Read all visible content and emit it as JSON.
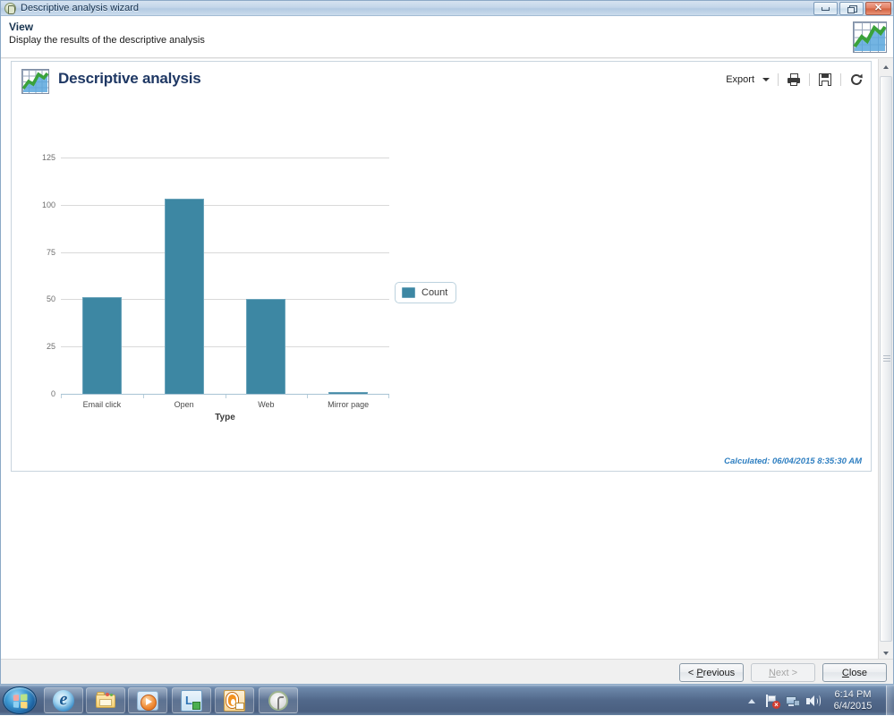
{
  "window": {
    "title": "Descriptive analysis wizard",
    "icon": "app-wizard-icon",
    "minimize_label": "",
    "maximize_label": "",
    "close_label": "✕"
  },
  "header": {
    "title": "View",
    "subtitle": "Display the results of the descriptive analysis",
    "icon": "chart-grid-icon"
  },
  "report": {
    "icon": "chart-grid-icon",
    "title": "Descriptive analysis",
    "toolbar": {
      "export_label": "Export",
      "export_caret": "caret-down-icon",
      "print_icon": "printer-icon",
      "save_icon": "save-disk-icon",
      "refresh_icon": "refresh-icon"
    },
    "calculated": "Calculated: 06/04/2015 8:35:30 AM"
  },
  "chart_data": {
    "type": "bar",
    "title": "Descriptive analysis",
    "categories": [
      "Email click",
      "Open",
      "Web",
      "Mirror page"
    ],
    "series": [
      {
        "name": "Count",
        "values": [
          51,
          103,
          50,
          1
        ],
        "color": "#3d87a3"
      }
    ],
    "xlabel": "Type",
    "ylabel": "",
    "ylim": [
      0,
      125
    ],
    "yticks": [
      0,
      25,
      50,
      75,
      100,
      125
    ],
    "ytick_labels": [
      "0",
      "25",
      "50",
      "75",
      "100",
      "125"
    ],
    "grid": true,
    "legend": {
      "position": "right",
      "entries": [
        "Count"
      ]
    }
  },
  "footer": {
    "previous_label": "< Previous",
    "previous_accel": "P",
    "next_label": "Next >",
    "next_enabled": false,
    "close_label": "Close",
    "close_accel": "C"
  },
  "scrollbar": {
    "up_arrow": "triangle-up-icon",
    "down_arrow": "triangle-down-icon"
  },
  "taskbar": {
    "start_label": "start-orb-icon",
    "items": [
      {
        "name": "internet-explorer",
        "icon": "internet-explorer-icon"
      },
      {
        "name": "windows-explorer",
        "icon": "folder-icon"
      },
      {
        "name": "media-player",
        "icon": "media-player-icon"
      },
      {
        "name": "lync",
        "icon": "lync-icon"
      },
      {
        "name": "outlook",
        "icon": "outlook-icon"
      },
      {
        "name": "app-circle",
        "icon": "circle-app-icon"
      }
    ],
    "tray": {
      "overflow_icon": "triangle-up-icon",
      "action_center_icon": "flag-alert-icon",
      "network_icon": "network-icon",
      "volume_icon": "speaker-icon",
      "time": "6:14 PM",
      "date": "6/4/2015"
    }
  },
  "colors": {
    "bar": "#3d87a3",
    "bar_border": "#6aa3ba",
    "title_text": "#1f3864",
    "calculated_text": "#2f7fc1",
    "gridline": "#d9d9d9"
  }
}
